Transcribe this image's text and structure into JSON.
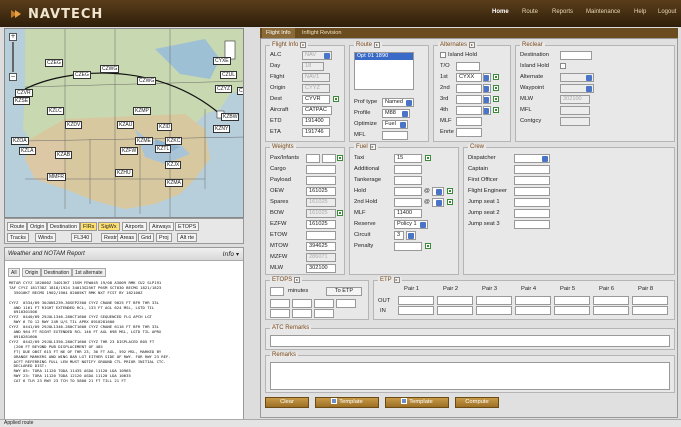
{
  "app": {
    "title": "NAVTECH"
  },
  "nav": [
    "Home",
    "Route",
    "Reports",
    "Maintenance",
    "Help",
    "Logout"
  ],
  "tabs": [
    "Flight Info",
    "Inflight Revision"
  ],
  "map": {
    "labels": [
      "CZEG",
      "CZWG",
      "CYXE",
      "CZEG",
      "CZWG",
      "CZVR",
      "CZUL",
      "CZYZ",
      "CZQX",
      "KZSE",
      "KZLC",
      "KZMP",
      "KZBW",
      "KZDV",
      "KZAU",
      "KZID",
      "KZNY",
      "KZOA",
      "KZLA",
      "KZAB",
      "KZFW",
      "KZTL",
      "KZKC",
      "KZME",
      "KZJX",
      "KZHU",
      "MMFR",
      "KZMA"
    ],
    "toolbar_row1": [
      "Route",
      "Origin",
      "Destination",
      "FIRs",
      "SigWx",
      "Airports",
      "Airways",
      "ETOPS"
    ],
    "toolbar_row2": [
      "Tracks",
      "Winds",
      "FL340",
      "Restr",
      "Areas",
      "Grid",
      "Proj",
      "Alt rte"
    ]
  },
  "weather": {
    "title": "Weather and NOTAM Report",
    "info": "Info",
    "tabs": [
      "All",
      "Origin",
      "Destination",
      "1st alternate"
    ],
    "text": "METAR CYYZ 182000Z 34013KT 15SM FEW045 19/08 A3009 RMK CU2 SLP191\nTAF CYYZ 181738Z 1818/1924 34013G25KT P6SM SCT030 BECMG 1821/1823\n  35010KT BECMG 1902/1904 02005KT RMK NXT FCST BY 182100Z\n\nCYYZ  0334/09 30JUN1239-30SEP2300 CYYZ CRANE 9025 FT BFR THR 33L\n  AND 1161 FT RIGHT EXTENDED RCL, 133 FT AGL 624 MSL, LGTD TIL\n  0910301500\nCYYZ  0440/09 29JUL1346-280CT1600 CYYZ SEQUENCED FLG APCH LGT\n  RWY 6 TO 12 RWY 24R U/S TIL APRX 0910281600\nCYYZ  0441/09 29JUL1346-280CT1600 CYYZ CRANE 6116 FT BFR THR 33L\n  AND 964 FT RIGHT EXTENDED RCL 140 FT AGL 698 MSL, LGTD TIL APRX\n  0910281600\nCYYZ  0442/09 29JUL1350-280CT1600 CYYZ THR 23 DISPLACED 605 FT\n  (200 FT BEYOND PUB DISPLACEMENT OF 485\n  FT) DUE OBST 615 FT NE OF THR 23, 30 FT AGL, 592 MSL, MARKED BY\n  ORANGE MARKERS AND WING BAR LGT EITHER SIDE OF RWY. FOR RWY 23 REF.\n  ACFT REFERRING FULL LEN MUST NOTIFY GROUND CTL PRIOR INITIAL CTC.\n  DECLARED DIST:\n  RWY 05: TORA 11120 TODA 11435 ASDA 11120 LDA 10965\n  RWY 23: TORA 11120 TODA 12120 ASDA 11120 LDA 10635\n  CAT 6 TLR 23 RWY 23 TCH TO 5800 21 FT TILL 21 FT"
  },
  "flight_info": {
    "legend": "Flight Info",
    "alc_label": "ALC",
    "alc": "NAV",
    "day_label": "Day",
    "day": "18",
    "flight_label": "Flight",
    "flight": "NAV1",
    "origin_label": "Origin",
    "origin": "CYYZ",
    "dest_label": "Dest",
    "dest": "CYVR",
    "aircraft_label": "Aircraft",
    "aircraft": "CATPAC",
    "etd_label": "ETD",
    "etd": "191400",
    "eta_label": "ETA",
    "eta": "191746"
  },
  "route": {
    "legend": "Route",
    "selected": "Opt 01 1890",
    "prof_type_label": "Prof type",
    "prof_type": "Named",
    "profile_label": "Profile",
    "profile": "M88",
    "optimize_label": "Optimize",
    "optimize": "Fuel",
    "mfl_label": "MFL",
    "mfl": ""
  },
  "alternates": {
    "legend": "Alternates",
    "island_hold": "Island Hold",
    "to_label": "T/O",
    "row_labels": [
      "1st",
      "2nd",
      "3rd",
      "4th"
    ],
    "first": "CYXX",
    "mlf_label": "MLF",
    "enrte_label": "Enrte"
  },
  "reclear": {
    "legend": "Reclear",
    "destination_label": "Destination",
    "island_hold_label": "Island Hold",
    "alternate_label": "Alternate",
    "waypoint_label": "Waypoint",
    "mlw_label": "MLW",
    "mlw": "302100",
    "mfl_label": "MFL",
    "contgcy_label": "Contgcy"
  },
  "weights": {
    "legend": "Weights",
    "rows": [
      {
        "label": "Pax/Infants",
        "value": ""
      },
      {
        "label": "Cargo",
        "value": ""
      },
      {
        "label": "Payload",
        "value": ""
      },
      {
        "label": "OEW",
        "value": "161025"
      },
      {
        "label": "Spares",
        "value": "161025"
      },
      {
        "label": "BOW",
        "value": "161025"
      },
      {
        "label": "EZFW",
        "value": "161025"
      },
      {
        "label": "ETOW",
        "value": ""
      },
      {
        "label": "MTOW",
        "value": "394625"
      },
      {
        "label": "MZFW",
        "value": "286071"
      },
      {
        "label": "MLW",
        "value": "302100"
      }
    ]
  },
  "fuel": {
    "legend": "Fuel",
    "rows": [
      {
        "label": "Taxi",
        "value": "15"
      },
      {
        "label": "Additional",
        "value": ""
      },
      {
        "label": "Tankerage",
        "value": ""
      },
      {
        "label": "Hold",
        "value": ""
      },
      {
        "label": "2nd Hold",
        "value": ""
      },
      {
        "label": "MLF",
        "value": "11400"
      },
      {
        "label": "Reserve",
        "value": "Policy 1"
      },
      {
        "label": "Circuit",
        "value": "3"
      },
      {
        "label": "Penalty",
        "value": ""
      }
    ],
    "at": "@"
  },
  "crew": {
    "legend": "Crew",
    "rows": [
      "Dispatcher",
      "Captain",
      "First Officer",
      "Flight Engineer",
      "Jump seat 1",
      "Jump seat 2",
      "Jump seat 3"
    ]
  },
  "etops": {
    "legend": "ETOPS",
    "minutes": "minutes",
    "to_etp": "To ETP"
  },
  "etp": {
    "legend": "ETP",
    "pairs": [
      "Pair 1",
      "Pair 2",
      "Pair 3",
      "Pair 4",
      "Pair 5",
      "Pair 6",
      "Pair 8"
    ],
    "out": "OUT",
    "in": "IN"
  },
  "atc_remarks": {
    "legend": "ATC Remarks"
  },
  "remarks": {
    "legend": "Remarks"
  },
  "buttons": {
    "clear": "Clear",
    "template1": "Template",
    "template2": "Template",
    "compute": "Compute"
  },
  "status": "Applied route"
}
